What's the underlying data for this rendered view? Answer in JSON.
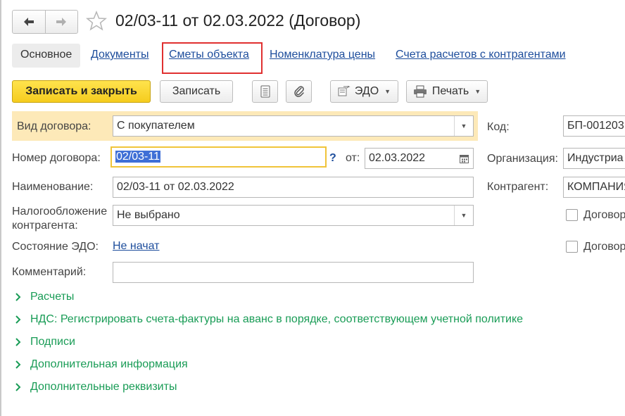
{
  "header": {
    "back_icon": "arrow-left-icon",
    "forward_icon": "arrow-right-icon",
    "favorite_icon": "star-icon",
    "title": "02/03-11 от 02.03.2022 (Договор)"
  },
  "tabs": [
    {
      "label": "Основное",
      "active": true
    },
    {
      "label": "Документы"
    },
    {
      "label": "Сметы объекта",
      "highlighted": true
    },
    {
      "label": "Номенклатура цены"
    },
    {
      "label": "Счета расчетов с контрагентами"
    }
  ],
  "toolbar": {
    "save_close": "Записать и закрыть",
    "save": "Записать",
    "report_icon": "list-document-icon",
    "attach_icon": "paperclip-icon",
    "edo": "ЭДО",
    "print": "Печать"
  },
  "form": {
    "contract_type": {
      "label": "Вид договора:",
      "value": "С покупателем"
    },
    "code": {
      "label": "Код:",
      "value": "БП-001203"
    },
    "number": {
      "label": "Номер договора:",
      "value": "02/03-11",
      "help": "?",
      "from_label": "от:",
      "date": "02.03.2022"
    },
    "organization": {
      "label": "Организация:",
      "value": "Индустриа"
    },
    "name": {
      "label": "Наименование:",
      "value": "02/03-11 от 02.03.2022"
    },
    "counterparty": {
      "label": "Контрагент:",
      "value": "КОМПАНИЯ"
    },
    "taxation": {
      "label_line1": "Налогообложение",
      "label_line2": "контрагента:",
      "value": "Не выбрано"
    },
    "check1": {
      "label": "Договор"
    },
    "edo_state": {
      "label": "Состояние ЭДО:",
      "value": "Не начат"
    },
    "check2": {
      "label": "Договор"
    },
    "comment": {
      "label": "Комментарий:",
      "value": ""
    }
  },
  "groups": [
    "Расчеты",
    "НДС: Регистрировать счета-фактуры на аванс в порядке, соответствующем учетной политике",
    "Подписи",
    "Дополнительная информация",
    "Дополнительные реквизиты"
  ],
  "colors": {
    "accent_link": "#1d4d9c",
    "group_green": "#199c56",
    "primary_button": "#f5cc1e",
    "highlight_row": "#fde9b8",
    "annotation_red": "#e03030"
  }
}
